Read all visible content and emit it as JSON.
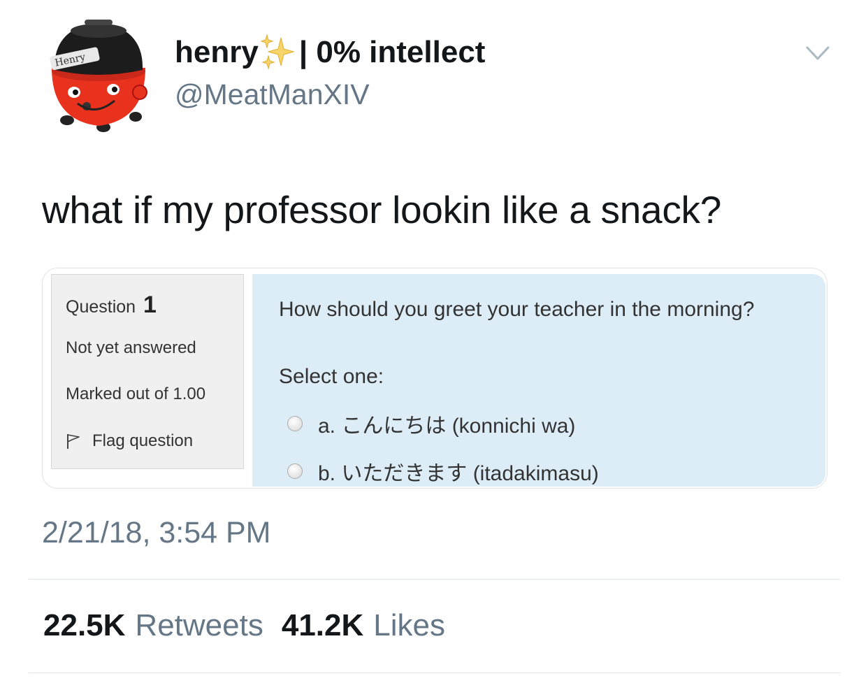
{
  "author": {
    "display_name": "henry",
    "name_suffix": "| 0% intellect",
    "handle": "@MeatManXIV",
    "avatar_text": "Henry"
  },
  "tweet": {
    "text": "what if my professor lookin like a snack?",
    "timestamp": "2/21/18, 3:54 PM"
  },
  "quiz": {
    "question_label": "Question",
    "question_number": "1",
    "status": "Not yet answered",
    "marked": "Marked out of 1.00",
    "flag_label": "Flag question",
    "question_text": "How should you greet your teacher in the morning?",
    "prompt": "Select one:",
    "options": [
      {
        "label": "a. こんにちは (konnichi wa)"
      },
      {
        "label": "b. いただきます (itadakimasu)"
      }
    ]
  },
  "stats": {
    "retweets_count": "22.5K",
    "retweets_label": "Retweets",
    "likes_count": "41.2K",
    "likes_label": "Likes"
  },
  "colors": {
    "text_primary": "#14171a",
    "text_secondary": "#657786",
    "quiz_content_bg": "#dcedf7",
    "quiz_info_bg": "#f0f0f0",
    "avatar_red": "#e8321e"
  },
  "icons": [
    "henry-vacuum-avatar",
    "sparkles-icon",
    "chevron-down-icon",
    "flag-icon",
    "radio-icon"
  ]
}
